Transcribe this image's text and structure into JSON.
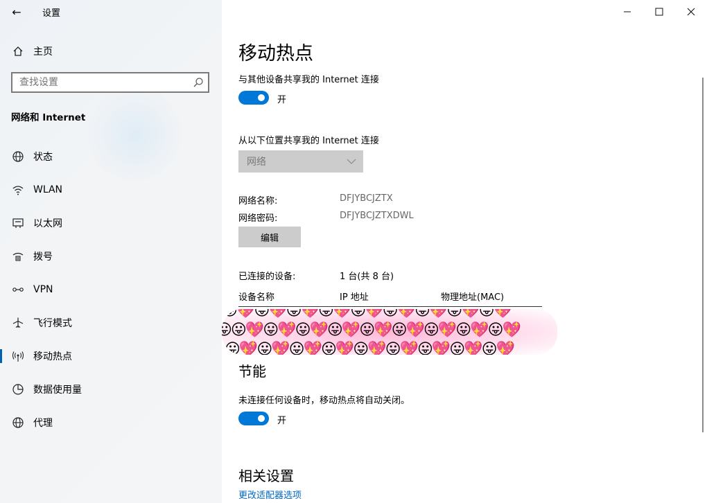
{
  "window": {
    "title": "设置",
    "back_icon": "←",
    "minimize_icon": "—",
    "maximize_icon": "☐",
    "close_icon": "✕"
  },
  "sidebar": {
    "home_label": "主页",
    "search_placeholder": "查找设置",
    "section_title": "网络和 Internet",
    "items": [
      {
        "label": "状态",
        "icon": "globe-status-icon"
      },
      {
        "label": "WLAN",
        "icon": "wifi-icon"
      },
      {
        "label": "以太网",
        "icon": "ethernet-icon"
      },
      {
        "label": "拨号",
        "icon": "dialup-icon"
      },
      {
        "label": "VPN",
        "icon": "vpn-icon"
      },
      {
        "label": "飞行模式",
        "icon": "airplane-icon"
      },
      {
        "label": "移动热点",
        "icon": "hotspot-icon",
        "active": true
      },
      {
        "label": "数据使用量",
        "icon": "data-usage-icon"
      },
      {
        "label": "代理",
        "icon": "globe-proxy-icon"
      }
    ]
  },
  "main": {
    "title": "移动热点",
    "share_label": "与其他设备共享我的 Internet 连接",
    "share_toggle_state": "开",
    "share_from_label": "从以下位置共享我的 Internet 连接",
    "share_from_value": "网络",
    "network_name_label": "网络名称:",
    "network_name_value": "DFJYBCJZTX",
    "network_password_label": "网络密码:",
    "network_password_value": "DFJYBCJZTXDWL",
    "edit_button": "编辑",
    "connected_label": "已连接的设备:",
    "connected_value": "1 台(共 8 台)",
    "table_headers": [
      "设备名称",
      "IP 地址",
      "物理地址(MAC)"
    ],
    "power_title": "节能",
    "power_desc": "未连接任何设备时，移动热点将自动关闭。",
    "power_toggle_state": "开",
    "related_title": "相关设置",
    "related_link": "更改适配器选项"
  },
  "colors": {
    "accent": "#0078d7",
    "link": "#0067c0",
    "button_gray": "#cccccc"
  }
}
